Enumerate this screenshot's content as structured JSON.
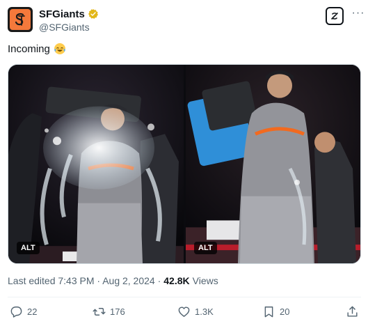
{
  "author": {
    "display_name": "SFGiants",
    "handle": "@SFGiants",
    "avatar_icon": "sf-giants-logo",
    "verified_icon": "verified-gold-badge",
    "brand_color": "#f4793b"
  },
  "tweet": {
    "text": "Incoming",
    "emoji": "laughing-tears-emoji"
  },
  "media": {
    "photos": [
      {
        "alt_label": "ALT",
        "description_icon": "gatorade-shower-photo"
      },
      {
        "alt_label": "ALT",
        "description_icon": "gatorade-shower-photo"
      }
    ]
  },
  "meta": {
    "edited_text": "Last edited 7:43 PM · Aug 2, 2024 ·",
    "views_count": "42.8K",
    "views_label": "Views"
  },
  "actions": {
    "replies": "22",
    "reposts": "176",
    "likes": "1.3K",
    "bookmarks": "20"
  },
  "icons": {
    "grok": "grok-icon",
    "more": "more-icon",
    "reply": "reply-icon",
    "repost": "repost-icon",
    "like": "heart-icon",
    "bookmark": "bookmark-icon",
    "share": "share-icon"
  }
}
